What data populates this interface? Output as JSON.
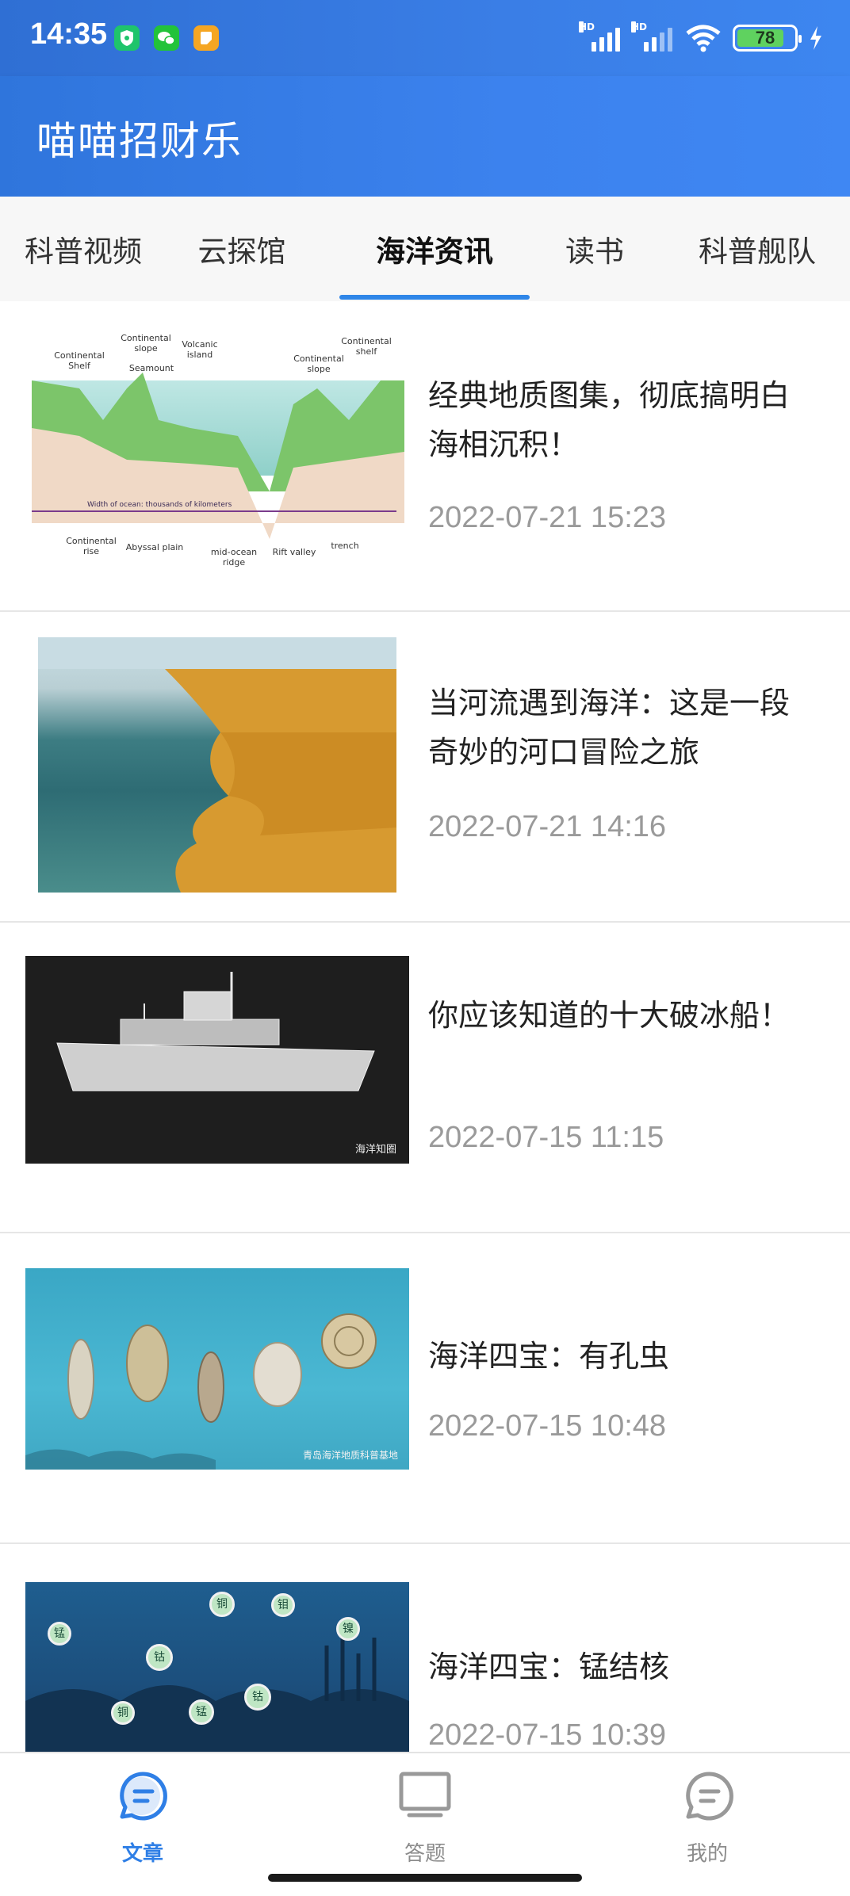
{
  "status_bar": {
    "time": "14:35",
    "battery": "78",
    "icons": [
      "shield-app-icon",
      "wechat-icon",
      "notes-app-icon",
      "hd-signal-icon",
      "hd-signal-icon",
      "wifi-icon",
      "battery-icon",
      "charging-icon"
    ],
    "hd_label": "HD"
  },
  "header": {
    "title": "喵喵招财乐"
  },
  "tabs": [
    {
      "label": "科普视频"
    },
    {
      "label": "云探馆"
    },
    {
      "label": "海洋资讯",
      "active": true
    },
    {
      "label": "读书"
    },
    {
      "label": "科普舰队"
    }
  ],
  "articles": [
    {
      "title": "经典地质图集，彻底搞明白海相沉积！",
      "date": "2022-07-21 15:23",
      "thumb_labels": [
        "Continental Shelf",
        "Continental slope",
        "Volcanic island",
        "Seamount",
        "Continental slope",
        "Continental shelf",
        "Continental rise",
        "Abyssal plain",
        "mid-ocean ridge",
        "Rift valley",
        "trench",
        "Width of ocean: thousands of kilometers"
      ]
    },
    {
      "title": "当河流遇到海洋：这是一段奇妙的河口冒险之旅",
      "date": "2022-07-21 14:16"
    },
    {
      "title": "你应该知道的十大破冰船！",
      "date": "2022-07-15 11:15",
      "watermark": "海洋知圈"
    },
    {
      "title": "海洋四宝：有孔虫",
      "date": "2022-07-15 10:48",
      "watermark": "青岛海洋地质科普基地"
    },
    {
      "title": "海洋四宝：锰结核",
      "date": "2022-07-15 10:39",
      "nodule_labels": [
        "锰",
        "铜",
        "钼",
        "钴",
        "镍",
        "铜",
        "锰",
        "钴"
      ]
    }
  ],
  "bottom_nav": [
    {
      "label": "文章",
      "icon": "article-icon",
      "active": true
    },
    {
      "label": "答题",
      "icon": "monitor-icon"
    },
    {
      "label": "我的",
      "icon": "profile-icon"
    }
  ],
  "colors": {
    "accent": "#2f86e8",
    "header": "#3a7ee6",
    "date_gray": "#9a9a9a"
  }
}
